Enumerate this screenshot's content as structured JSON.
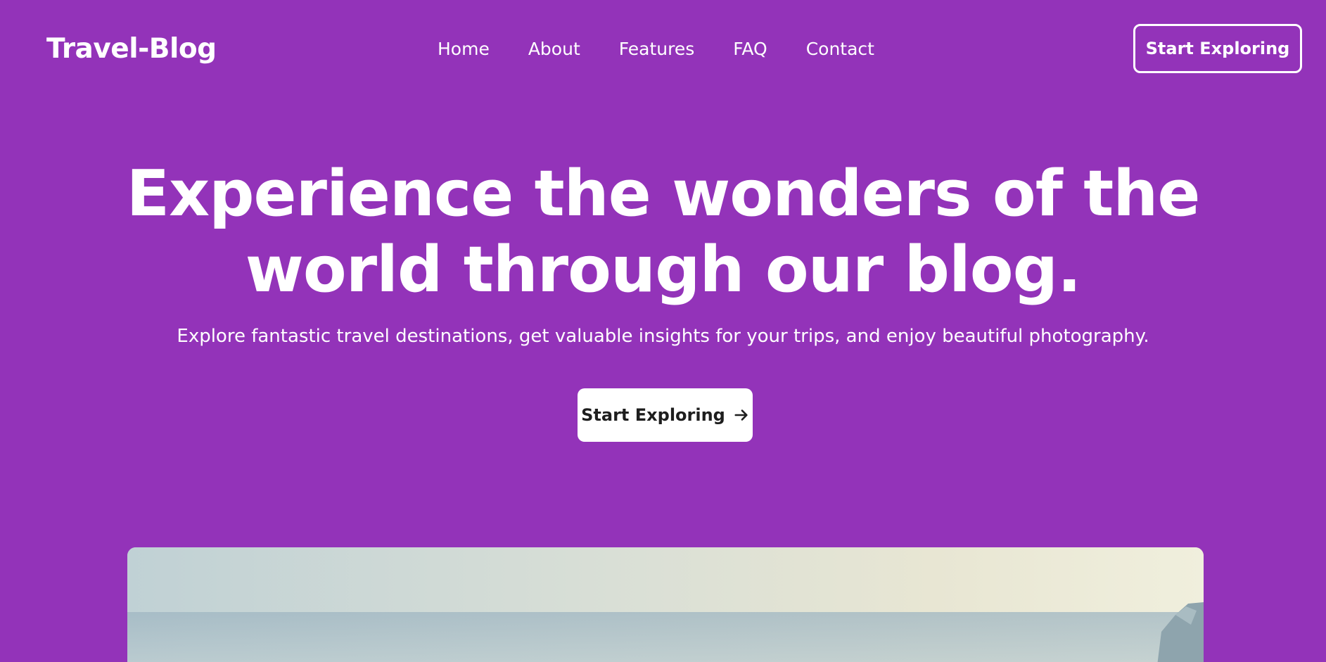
{
  "header": {
    "logo": "Travel-Blog",
    "nav": [
      {
        "label": "Home"
      },
      {
        "label": "About"
      },
      {
        "label": "Features"
      },
      {
        "label": "FAQ"
      },
      {
        "label": "Contact"
      }
    ],
    "cta_label": "Start Exploring"
  },
  "hero": {
    "title_line1": "Experience the wonders of the",
    "title_line2": "world through our blog.",
    "subtitle": "Explore fantastic travel destinations, get valuable insights for your trips, and enjoy beautiful photography.",
    "cta_label": "Start Exploring",
    "cta_icon": "arrow-right-icon"
  },
  "colors": {
    "background": "#9333b9",
    "text": "#ffffff",
    "button_bg": "#ffffff",
    "button_text": "#1e1e1e"
  }
}
